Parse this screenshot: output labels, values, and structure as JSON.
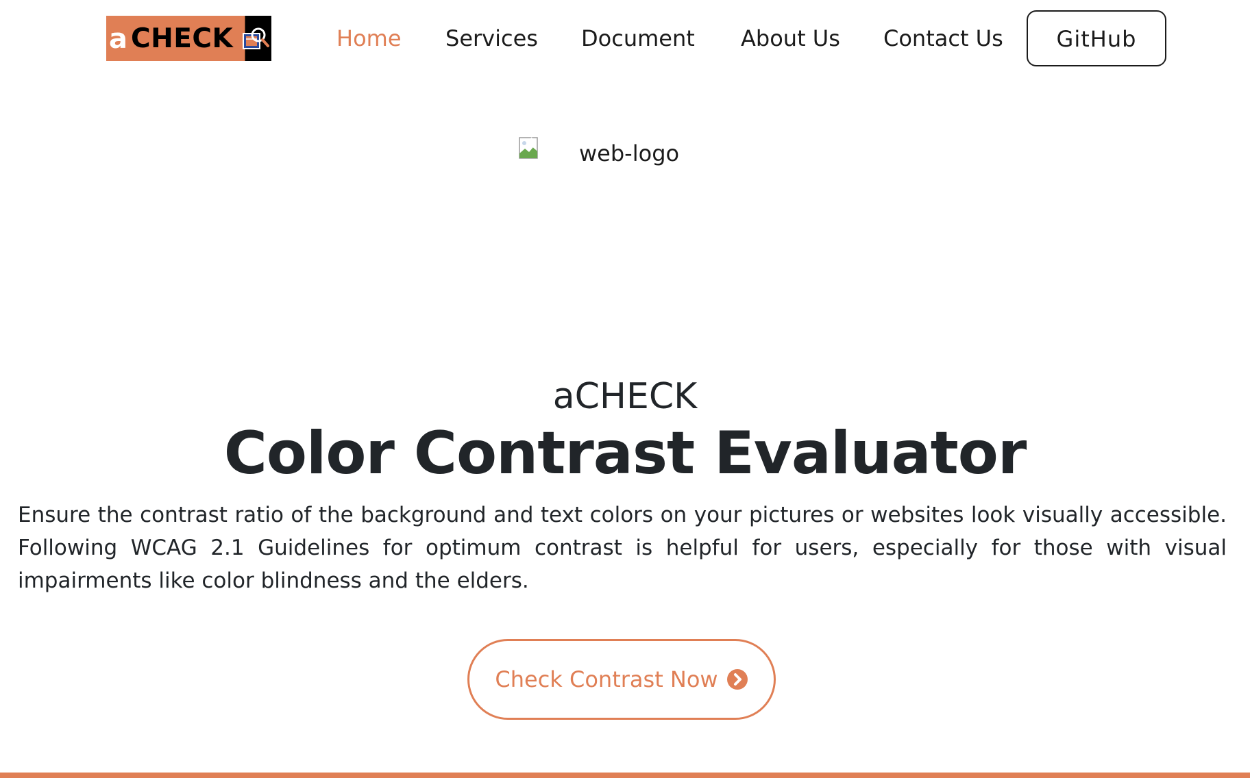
{
  "brand": {
    "prefix": "a",
    "name": "CHECK",
    "accent_color": "#e07f55"
  },
  "nav": {
    "items": [
      {
        "label": "Home",
        "active": true
      },
      {
        "label": "Services",
        "active": false
      },
      {
        "label": "Document",
        "active": false
      },
      {
        "label": "About Us",
        "active": false
      },
      {
        "label": "Contact Us",
        "active": false
      }
    ],
    "github_label": "GitHub"
  },
  "hero": {
    "image_alt": "web-logo",
    "subtitle": "aCHECK",
    "title": "Color Contrast Evaluator",
    "description": "Ensure the contrast ratio of the background and text colors on your pictures or websites look visually accessible. Following WCAG 2.1 Guidelines for optimum contrast is helpful for users, especially for those with visual impairments like color blindness and the elders.",
    "cta_label": "Check Contrast Now",
    "cta_icon": "chevron-right-circle-icon"
  },
  "colors": {
    "accent": "#e07f55",
    "text": "#212529"
  }
}
